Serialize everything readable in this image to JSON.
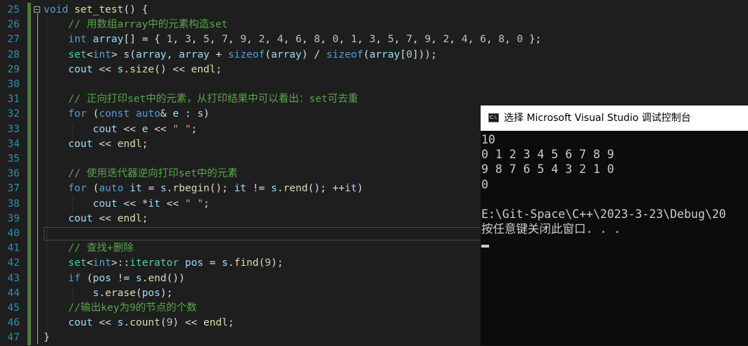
{
  "editor": {
    "line_numbers": [
      "25",
      "26",
      "27",
      "28",
      "29",
      "30",
      "31",
      "32",
      "33",
      "34",
      "35",
      "36",
      "37",
      "38",
      "39",
      "40",
      "41",
      "42",
      "43",
      "44",
      "45",
      "46",
      "47"
    ],
    "lines": [
      [
        [
          "kw",
          "void"
        ],
        [
          "id",
          " "
        ],
        [
          "fn",
          "set_test"
        ],
        [
          "id",
          "() {"
        ]
      ],
      [
        [
          "id",
          "    "
        ],
        [
          "cm",
          "// 用数组array中的元素构造set"
        ]
      ],
      [
        [
          "id",
          "    "
        ],
        [
          "kw",
          "int"
        ],
        [
          "id",
          " "
        ],
        [
          "var",
          "array"
        ],
        [
          "id",
          "[] = { "
        ],
        [
          "num",
          "1"
        ],
        [
          "id",
          ", "
        ],
        [
          "num",
          "3"
        ],
        [
          "id",
          ", "
        ],
        [
          "num",
          "5"
        ],
        [
          "id",
          ", "
        ],
        [
          "num",
          "7"
        ],
        [
          "id",
          ", "
        ],
        [
          "num",
          "9"
        ],
        [
          "id",
          ", "
        ],
        [
          "num",
          "2"
        ],
        [
          "id",
          ", "
        ],
        [
          "num",
          "4"
        ],
        [
          "id",
          ", "
        ],
        [
          "num",
          "6"
        ],
        [
          "id",
          ", "
        ],
        [
          "num",
          "8"
        ],
        [
          "id",
          ", "
        ],
        [
          "num",
          "0"
        ],
        [
          "id",
          ", "
        ],
        [
          "num",
          "1"
        ],
        [
          "id",
          ", "
        ],
        [
          "num",
          "3"
        ],
        [
          "id",
          ", "
        ],
        [
          "num",
          "5"
        ],
        [
          "id",
          ", "
        ],
        [
          "num",
          "7"
        ],
        [
          "id",
          ", "
        ],
        [
          "num",
          "9"
        ],
        [
          "id",
          ", "
        ],
        [
          "num",
          "2"
        ],
        [
          "id",
          ", "
        ],
        [
          "num",
          "4"
        ],
        [
          "id",
          ", "
        ],
        [
          "num",
          "6"
        ],
        [
          "id",
          ", "
        ],
        [
          "num",
          "8"
        ],
        [
          "id",
          ", "
        ],
        [
          "num",
          "0"
        ],
        [
          "id",
          " };"
        ]
      ],
      [
        [
          "id",
          "    "
        ],
        [
          "ty",
          "set"
        ],
        [
          "id",
          "<"
        ],
        [
          "kw",
          "int"
        ],
        [
          "id",
          "> "
        ],
        [
          "var",
          "s"
        ],
        [
          "id",
          "("
        ],
        [
          "var",
          "array"
        ],
        [
          "id",
          ", "
        ],
        [
          "var",
          "array"
        ],
        [
          "id",
          " + "
        ],
        [
          "kw",
          "sizeof"
        ],
        [
          "id",
          "("
        ],
        [
          "var",
          "array"
        ],
        [
          "id",
          ") / "
        ],
        [
          "kw",
          "sizeof"
        ],
        [
          "id",
          "("
        ],
        [
          "var",
          "array"
        ],
        [
          "id",
          "["
        ],
        [
          "num",
          "0"
        ],
        [
          "id",
          "]));"
        ]
      ],
      [
        [
          "id",
          "    "
        ],
        [
          "var",
          "cout"
        ],
        [
          "id",
          " << "
        ],
        [
          "var",
          "s"
        ],
        [
          "id",
          "."
        ],
        [
          "fn",
          "size"
        ],
        [
          "id",
          "() << "
        ],
        [
          "fn",
          "endl"
        ],
        [
          "id",
          ";"
        ]
      ],
      [
        [
          "id",
          ""
        ]
      ],
      [
        [
          "id",
          "    "
        ],
        [
          "cm",
          "// 正向打印set中的元素，从打印结果中可以看出：set可去重"
        ]
      ],
      [
        [
          "id",
          "    "
        ],
        [
          "kw",
          "for"
        ],
        [
          "id",
          " ("
        ],
        [
          "kw",
          "const"
        ],
        [
          "id",
          " "
        ],
        [
          "kw",
          "auto"
        ],
        [
          "id",
          "& "
        ],
        [
          "var",
          "e"
        ],
        [
          "id",
          " : "
        ],
        [
          "var",
          "s"
        ],
        [
          "id",
          ")"
        ]
      ],
      [
        [
          "id",
          "        "
        ],
        [
          "var",
          "cout"
        ],
        [
          "id",
          " << "
        ],
        [
          "var",
          "e"
        ],
        [
          "id",
          " << "
        ],
        [
          "str",
          "\" \""
        ],
        [
          "id",
          ";"
        ]
      ],
      [
        [
          "id",
          "    "
        ],
        [
          "var",
          "cout"
        ],
        [
          "id",
          " << "
        ],
        [
          "fn",
          "endl"
        ],
        [
          "id",
          ";"
        ]
      ],
      [
        [
          "id",
          ""
        ]
      ],
      [
        [
          "id",
          "    "
        ],
        [
          "cm",
          "// 使用迭代器逆向打印set中的元素"
        ]
      ],
      [
        [
          "id",
          "    "
        ],
        [
          "kw",
          "for"
        ],
        [
          "id",
          " ("
        ],
        [
          "kw",
          "auto"
        ],
        [
          "id",
          " "
        ],
        [
          "var",
          "it"
        ],
        [
          "id",
          " = "
        ],
        [
          "var",
          "s"
        ],
        [
          "id",
          "."
        ],
        [
          "fn",
          "rbegin"
        ],
        [
          "id",
          "(); "
        ],
        [
          "var",
          "it"
        ],
        [
          "id",
          " != "
        ],
        [
          "var",
          "s"
        ],
        [
          "id",
          "."
        ],
        [
          "fn",
          "rend"
        ],
        [
          "id",
          "(); ++"
        ],
        [
          "var",
          "it"
        ],
        [
          "id",
          ")"
        ]
      ],
      [
        [
          "id",
          "        "
        ],
        [
          "var",
          "cout"
        ],
        [
          "id",
          " << *"
        ],
        [
          "var",
          "it"
        ],
        [
          "id",
          " << "
        ],
        [
          "str",
          "\" \""
        ],
        [
          "id",
          ";"
        ]
      ],
      [
        [
          "id",
          "    "
        ],
        [
          "var",
          "cout"
        ],
        [
          "id",
          " << "
        ],
        [
          "fn",
          "endl"
        ],
        [
          "id",
          ";"
        ]
      ],
      [
        [
          "id",
          ""
        ]
      ],
      [
        [
          "id",
          "    "
        ],
        [
          "cm",
          "// 查找+删除"
        ]
      ],
      [
        [
          "id",
          "    "
        ],
        [
          "ty",
          "set"
        ],
        [
          "id",
          "<"
        ],
        [
          "kw",
          "int"
        ],
        [
          "id",
          ">::"
        ],
        [
          "ty",
          "iterator"
        ],
        [
          "id",
          " "
        ],
        [
          "var",
          "pos"
        ],
        [
          "id",
          " = "
        ],
        [
          "var",
          "s"
        ],
        [
          "id",
          "."
        ],
        [
          "fn",
          "find"
        ],
        [
          "id",
          "("
        ],
        [
          "num",
          "9"
        ],
        [
          "id",
          ");"
        ]
      ],
      [
        [
          "id",
          "    "
        ],
        [
          "kw",
          "if"
        ],
        [
          "id",
          " ("
        ],
        [
          "var",
          "pos"
        ],
        [
          "id",
          " != "
        ],
        [
          "var",
          "s"
        ],
        [
          "id",
          "."
        ],
        [
          "fn",
          "end"
        ],
        [
          "id",
          "())"
        ]
      ],
      [
        [
          "id",
          "        "
        ],
        [
          "var",
          "s"
        ],
        [
          "id",
          "."
        ],
        [
          "fn",
          "erase"
        ],
        [
          "id",
          "("
        ],
        [
          "var",
          "pos"
        ],
        [
          "id",
          ");"
        ]
      ],
      [
        [
          "id",
          "    "
        ],
        [
          "cm",
          "//输出key为9的节点的个数"
        ]
      ],
      [
        [
          "id",
          "    "
        ],
        [
          "var",
          "cout"
        ],
        [
          "id",
          " << "
        ],
        [
          "var",
          "s"
        ],
        [
          "id",
          "."
        ],
        [
          "fn",
          "count"
        ],
        [
          "id",
          "("
        ],
        [
          "num",
          "9"
        ],
        [
          "id",
          ") << "
        ],
        [
          "fn",
          "endl"
        ],
        [
          "id",
          ";"
        ]
      ],
      [
        [
          "id",
          "}"
        ]
      ]
    ]
  },
  "console": {
    "icon_text": "C:\\",
    "title": "选择 Microsoft Visual Studio 调试控制台",
    "output": [
      "10",
      "0 1 2 3 4 5 6 7 8 9",
      "9 8 7 6 5 4 3 2 1 0",
      "0",
      "",
      "E:\\Git-Space\\C++\\2023-3-23\\Debug\\20",
      "按任意键关闭此窗口. . ."
    ]
  }
}
